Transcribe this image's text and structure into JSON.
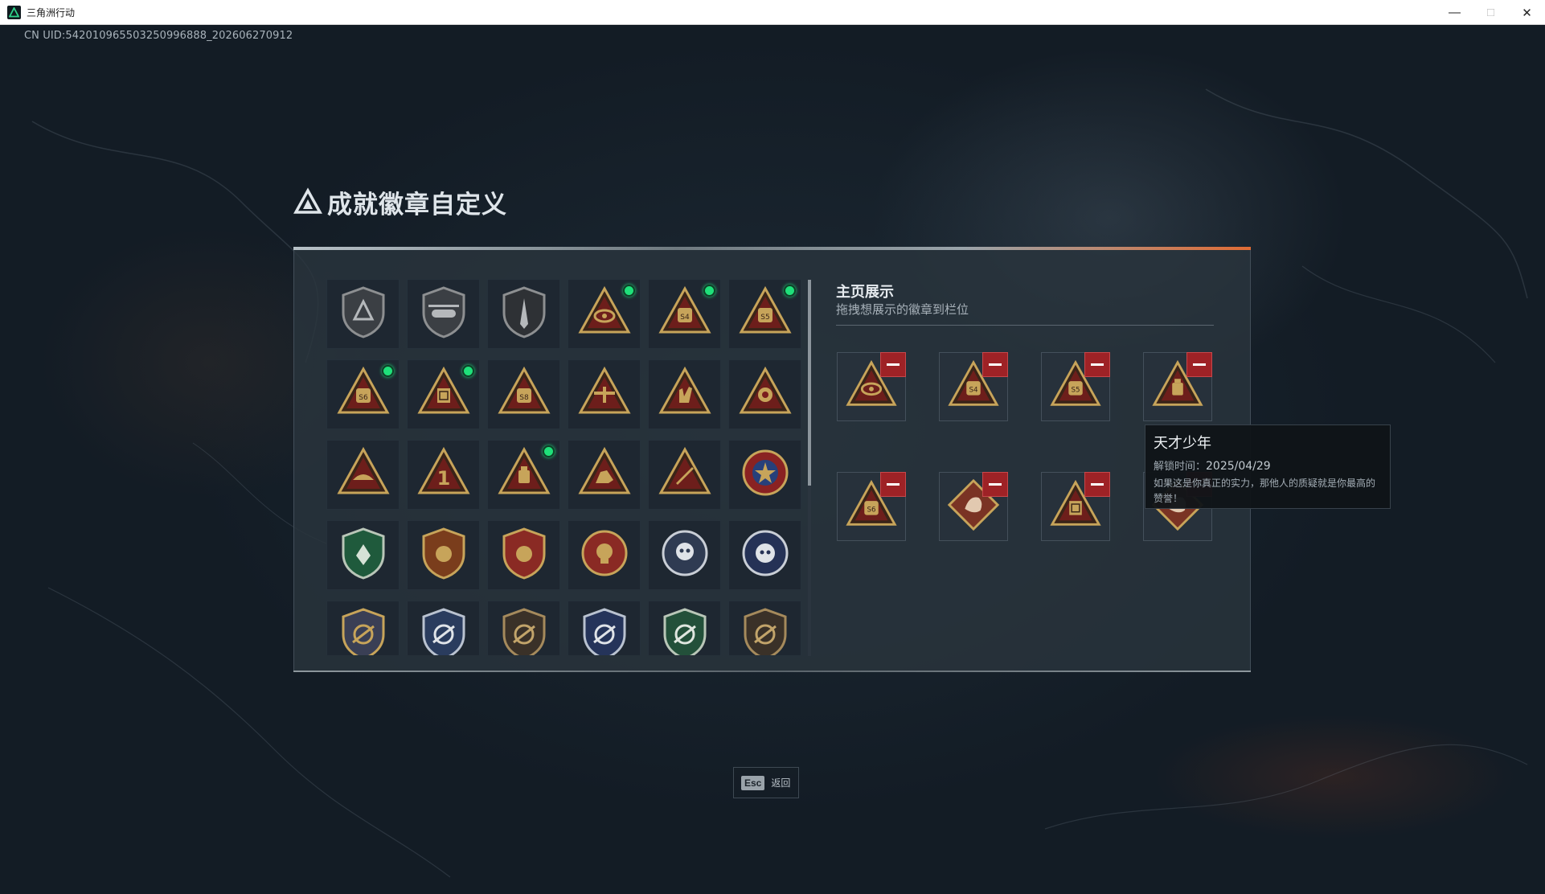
{
  "window": {
    "title": "三角洲行动",
    "minimize_icon": "minimize-icon",
    "maximize_icon": "maximize-icon",
    "close_icon": "close-icon"
  },
  "uid": "CN UID:542010965503250996888_202606270912",
  "dialog": {
    "title": "成就徽章自定义"
  },
  "badges": [
    {
      "icon": "shield-delta-badge",
      "new": false
    },
    {
      "icon": "helicopter-badge",
      "new": false
    },
    {
      "icon": "blade-shield-badge",
      "new": false
    },
    {
      "icon": "red-eye-triangle-badge",
      "new": true
    },
    {
      "icon": "s4-triangle-badge",
      "new": true
    },
    {
      "icon": "s5-triangle-badge",
      "new": true
    },
    {
      "icon": "s6-triangle-badge",
      "new": true
    },
    {
      "icon": "book-triangle-badge",
      "new": true
    },
    {
      "icon": "s8-triangle-badge",
      "new": false
    },
    {
      "icon": "plane-triangle-badge",
      "new": false
    },
    {
      "icon": "hand-triangle-badge",
      "new": false
    },
    {
      "icon": "star-triangle-badge",
      "new": false
    },
    {
      "icon": "hat-triangle-badge",
      "new": false
    },
    {
      "icon": "number-one-triangle-badge",
      "new": false
    },
    {
      "icon": "jar-triangle-badge",
      "new": true
    },
    {
      "icon": "creature-triangle-badge",
      "new": false
    },
    {
      "icon": "sword-triangle-badge",
      "new": false
    },
    {
      "icon": "star-medal-badge",
      "new": false
    },
    {
      "icon": "green-shield-badge",
      "new": false
    },
    {
      "icon": "gold-wing-shield-badge",
      "new": false
    },
    {
      "icon": "red-wing-shield-badge",
      "new": false
    },
    {
      "icon": "skull-target-badge",
      "new": false
    },
    {
      "icon": "silver-skull-badge",
      "new": false
    },
    {
      "icon": "silver-burst-skull-badge",
      "new": false
    },
    {
      "icon": "gold-rifle-shield-badge",
      "new": false
    },
    {
      "icon": "blue-rifle-shield-badge",
      "new": false
    },
    {
      "icon": "bronze-rifle-shield-badge",
      "new": false
    },
    {
      "icon": "navy-rifle-shield-badge",
      "new": false
    },
    {
      "icon": "green-rifle-shield-badge",
      "new": false
    },
    {
      "icon": "brown-rifle-shield-badge",
      "new": false
    }
  ],
  "showcase": {
    "title": "主页展示",
    "subtitle": "拖拽想展示的徽章到栏位",
    "slots": [
      {
        "icon": "red-eye-triangle-badge"
      },
      {
        "icon": "s4-triangle-badge"
      },
      {
        "icon": "s5-triangle-badge"
      },
      {
        "icon": "jar-triangle-badge"
      },
      {
        "icon": "s6-triangle-badge"
      },
      {
        "icon": "dragon-diamond-badge"
      },
      {
        "icon": "book-triangle-badge"
      },
      {
        "icon": "dragon-diamond-badge"
      }
    ]
  },
  "tooltip": {
    "title": "天才少年",
    "unlock_label": "解锁时间：",
    "unlock_date": "2025/04/29",
    "description": "如果这是你真正的实力，那他人的质疑就是你最高的赞誉！"
  },
  "footer": {
    "esc_key": "Esc",
    "esc_label": "返回"
  },
  "colors": {
    "gold": "#c7a45a",
    "badge_red": "#7a1d1d",
    "new_dot": "#1fe07a",
    "remove_red": "#9e2226"
  }
}
